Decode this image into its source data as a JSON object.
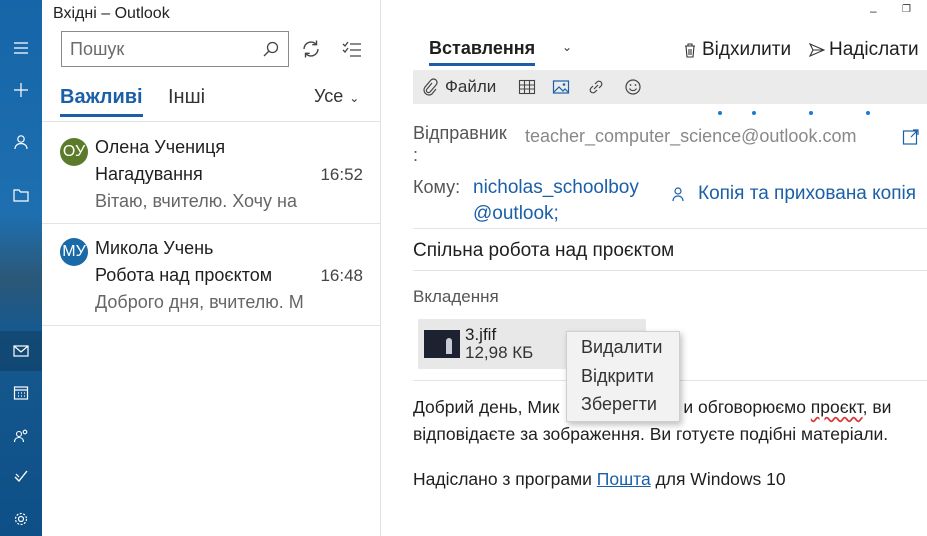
{
  "window": {
    "title": "Вхідні – Outlook",
    "minimize": "–",
    "maximize": "❐"
  },
  "rail": {
    "items": [
      "menu",
      "new-mail",
      "accounts",
      "folders",
      "mail",
      "calendar",
      "people",
      "todo",
      "settings"
    ]
  },
  "search": {
    "placeholder": "Пошук"
  },
  "tabs": {
    "focused": "Важливі",
    "other": "Інші",
    "filter": "Усе",
    "filter_chevron": "⌄"
  },
  "messages": [
    {
      "initials": "ОУ",
      "avatar_color": "#5b7a2a",
      "sender": "Олена Учениця",
      "subject": "Нагадування",
      "time": "16:52",
      "preview": "Вітаю, вчителю. Хочу на"
    },
    {
      "initials": "МУ",
      "avatar_color": "#1b6aa8",
      "sender": "Микола Учень",
      "subject": "Робота над проєктом",
      "time": "16:48",
      "preview": "Доброго дня, вчителю. М"
    }
  ],
  "compose": {
    "tab_insert": "Вставлення",
    "tab_chevron": "⌄",
    "discard_label": "Відхилити",
    "send_label": "Надіслати",
    "toolbar": {
      "files_label": "Файли"
    },
    "from_label": "Відправник :",
    "from_value": "teacher_computer_science@outlook.com",
    "to_label": "Кому:",
    "to_value": "nicholas_schoolboy @outlook;",
    "cc_label": "Копія та прихована копія",
    "subject": "Спільна робота над проєктом",
    "attachments_label": "Вкладення",
    "attachment": {
      "name": "3.jfif",
      "size": "12,98 КБ"
    },
    "body_1a": "Добрий день, Мик",
    "body_1b": "и обговорюємо ",
    "body_1c": "проєкт",
    "body_1d": ", ви",
    "body_2": "відповідаєте за зображення. Ви готуєте подібні матеріали.",
    "signature_prefix": "Надіслано з програми ",
    "signature_link": "Пошта",
    "signature_suffix": " для Windows 10"
  },
  "context_menu": {
    "items": [
      "Видалити",
      "Відкрити",
      "Зберегти"
    ]
  },
  "colors": {
    "accent": "#1a5fa8",
    "rail": "#1565a8"
  }
}
